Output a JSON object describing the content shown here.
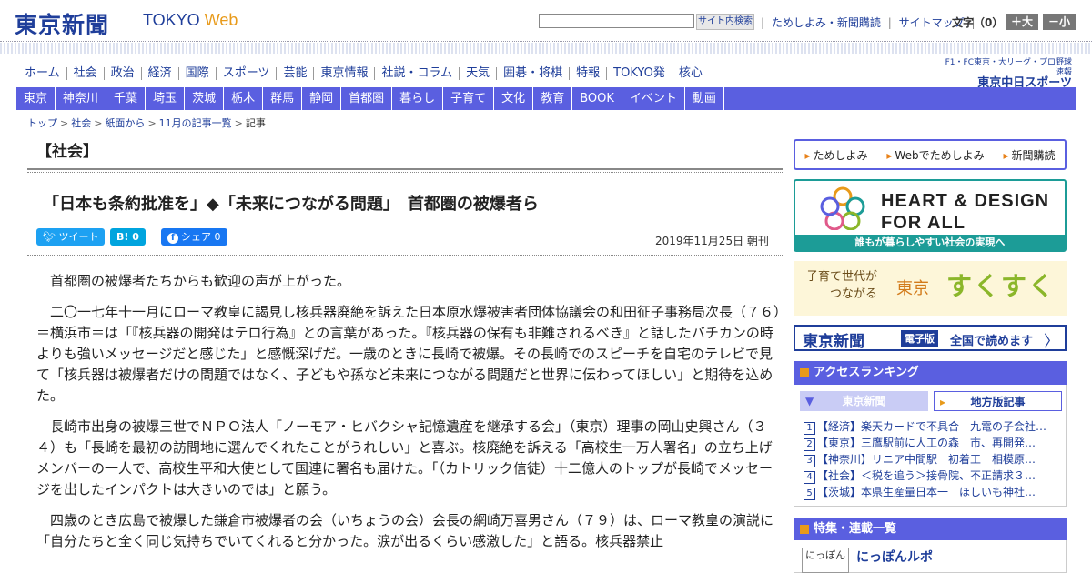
{
  "header": {
    "logo": "東京新聞",
    "logo_en_prefix": "TOKYO ",
    "logo_en_web": "Web",
    "search_placeholder": "",
    "search_button": "サイト内検索",
    "links": [
      "ためしよみ・新聞購読",
      "サイトマップ"
    ],
    "font_label": "文字（0）",
    "font_up": "＋大",
    "font_down": "－小"
  },
  "nav_main": [
    "ホーム",
    "社会",
    "政治",
    "経済",
    "国際",
    "スポーツ",
    "芸能",
    "東京情報",
    "社説・コラム",
    "天気",
    "囲碁・将棋",
    "特報",
    "TOKYO発",
    "核心"
  ],
  "chunichi": {
    "line1": "F1・FC東京・大リーグ・プロ野球速報",
    "line2": "東京中日スポーツ"
  },
  "nav_region": [
    "東京",
    "神奈川",
    "千葉",
    "埼玉",
    "茨城",
    "栃木",
    "群馬",
    "静岡",
    "首都圏",
    "暮らし",
    "子育て",
    "文化",
    "教育",
    "BOOK",
    "イベント",
    "動画"
  ],
  "breadcrumb": [
    "トップ",
    "社会",
    "紙面から",
    "11月の記事一覧",
    "記事"
  ],
  "article": {
    "section": "【社会】",
    "headline": "「日本も条約批准を」◆「未来につながる問題」　首都圏の被爆者ら",
    "share": {
      "tweet": "ツイート",
      "hatena": "B!",
      "hatena_count": "0",
      "facebook": "シェア",
      "facebook_count": "0"
    },
    "date": "2019年11月25日 朝刊",
    "paragraphs": [
      "首都圏の被爆者たちからも歓迎の声が上がった。",
      "二〇一七年十一月にローマ教皇に謁見し核兵器廃絶を訴えた日本原水爆被害者団体協議会の和田征子事務局次長（７６）＝横浜市＝は「『核兵器の開発はテロ行為』との言葉があった。『核兵器の保有も非難されるべき』と話したバチカンの時よりも強いメッセージだと感じた」と感慨深げだ。一歳のときに長崎で被爆。その長崎でのスピーチを自宅のテレビで見て「核兵器は被爆者だけの問題ではなく、子どもや孫など未来につながる問題だと世界に伝わってほしい」と期待を込めた。",
      "長崎市出身の被爆三世でＮＰＯ法人「ノーモア・ヒバクシャ記憶遺産を継承する会」（東京）理事の岡山史興さん（３４）も「長崎を最初の訪問地に選んでくれたことがうれしい」と喜ぶ。核廃絶を訴える「高校生一万人署名」の立ち上げメンバーの一人で、高校生平和大使として国連に署名も届けた。「（カトリック信徒）十二億人のトップが長崎でメッセージを出したインパクトは大きいのでは」と願う。",
      "四歳のとき広島で被爆した鎌倉市被爆者の会（いちょうの会）会長の網崎万喜男さん（７９）は、ローマ教皇の演説に「自分たちと全く同じ気持ちでいてくれると分かった。涙が出るくらい感激した」と語る。核兵器禁止"
    ]
  },
  "sidebar": {
    "buttons": [
      "ためしよみ",
      "Webでためしよみ",
      "新聞購読"
    ],
    "hd_title_line1": "HEART & DESIGN",
    "hd_title_line2": "FOR ALL",
    "hd_footer": "誰もが暮らしやすい社会の実現へ",
    "ss_line1": "子育て世代が",
    "ss_line2": "つながる",
    "ss_city": "東京",
    "ss_big": "すくすく",
    "ed_logo": "東京新聞",
    "ed_tag": "電子版",
    "ed_text": "全国で読めます",
    "ranking_title": "アクセスランキング",
    "ranking_tabs": [
      "東京新聞",
      "地方版記事"
    ],
    "ranking": [
      {
        "n": "1",
        "t": "【経済】楽天カードで不具合　九電の子会社…"
      },
      {
        "n": "2",
        "t": "【東京】三鷹駅前に人工の森　市、再開発…"
      },
      {
        "n": "3",
        "t": "【神奈川】リニア中間駅　初着工　相模原…"
      },
      {
        "n": "4",
        "t": "【社会】＜税を追う＞接骨院、不正請求３…"
      },
      {
        "n": "5",
        "t": "【茨城】本県生産量日本一　ほしいも神社…"
      }
    ],
    "feature_title": "特集・連載一覧",
    "feature_item": "にっぽんルポ",
    "feature_thumb": "にっぽん"
  },
  "colors": {
    "brand": "#1f3e9a",
    "nav": "#5a5fe0",
    "accent": "#e89a1a",
    "teal": "#1c9c97"
  }
}
